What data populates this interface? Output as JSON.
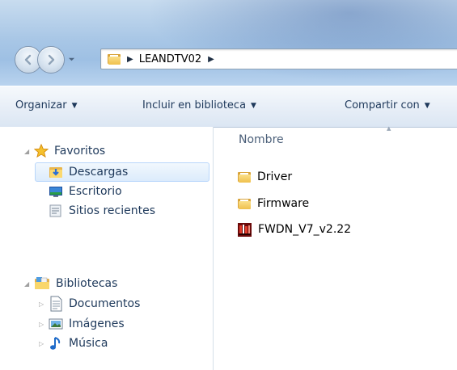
{
  "address_bar": {
    "crumbs": [
      "LEANDTV02"
    ]
  },
  "toolbar": {
    "organize": "Organizar",
    "include_library": "Incluir en biblioteca",
    "share_with": "Compartir con"
  },
  "nav": {
    "favorites": "Favoritos",
    "downloads": "Descargas",
    "desktop": "Escritorio",
    "recent": "Sitios recientes",
    "libraries": "Bibliotecas",
    "documents": "Documentos",
    "images": "Imágenes",
    "music": "Música"
  },
  "content": {
    "column_name": "Nombre",
    "files": [
      {
        "name": "Driver",
        "icon": "folder-icon"
      },
      {
        "name": "Firmware",
        "icon": "folder-icon"
      },
      {
        "name": "FWDN_V7_v2.22",
        "icon": "application-icon"
      }
    ]
  },
  "colors": {
    "chrome_blue": "#a9c7e6",
    "selection": "#dcebfc",
    "text_blue": "#1e395b"
  }
}
